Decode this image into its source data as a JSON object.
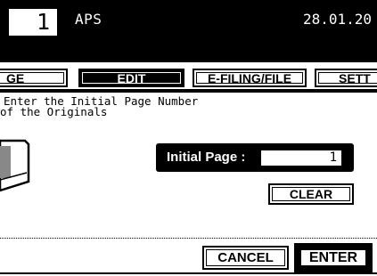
{
  "status": {
    "copy_count": "1",
    "paper_mode": "APS",
    "date": "28.01.20"
  },
  "tabs": [
    {
      "label": "GE"
    },
    {
      "label": "EDIT"
    },
    {
      "label": "E-FILING/FILE"
    },
    {
      "label": "SETT"
    }
  ],
  "message": {
    "line1": "Enter the Initial Page Number",
    "line2": "of the Originals"
  },
  "initial_page": {
    "label": "Initial Page :",
    "value": "1"
  },
  "buttons": {
    "clear": "CLEAR",
    "cancel": "CANCEL",
    "enter": "ENTER"
  },
  "icons": {
    "originals": "document-stack-icon"
  }
}
